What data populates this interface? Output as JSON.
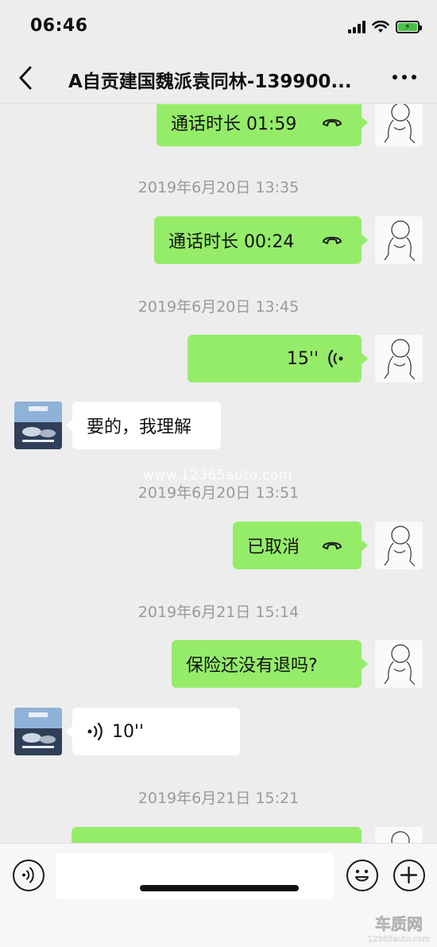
{
  "status_bar": {
    "time": "06:46",
    "battery_color": "#47c247"
  },
  "nav": {
    "title": "A自贡建国魏派袁同林-139900...",
    "back_icon": "chevron-left-icon",
    "more_icon": "ellipsis-icon"
  },
  "timestamps": [
    "2019年6月20日 13:35",
    "2019年6月20日 13:45",
    "2019年6月20日 13:51",
    "2019年6月21日 15:14",
    "2019年6月21日 15:21"
  ],
  "messages": [
    {
      "text": "通话时长 01:59",
      "icon": "call-end-icon"
    },
    {
      "text": "通话时长 00:24",
      "icon": "call-end-icon"
    },
    {
      "text": "15''",
      "icon": "voice-wave-icon"
    },
    {
      "text": "要的，我理解"
    },
    {
      "text": "已取消",
      "icon": "call-end-icon"
    },
    {
      "text": "保险还没有退吗?"
    },
    {
      "text": "10''",
      "icon": "voice-wave-icon"
    }
  ],
  "watermark": "www.12365auto.com",
  "input_bar": {
    "voice_icon": "voice-input-icon",
    "emoji_icon": "emoji-icon",
    "plus_icon": "plus-icon"
  },
  "logo": {
    "name": "车质网",
    "url": "12365auto.com"
  },
  "colors": {
    "outgoing_bubble": "#95ec69",
    "incoming_bubble": "#ffffff",
    "background": "#ededed"
  }
}
